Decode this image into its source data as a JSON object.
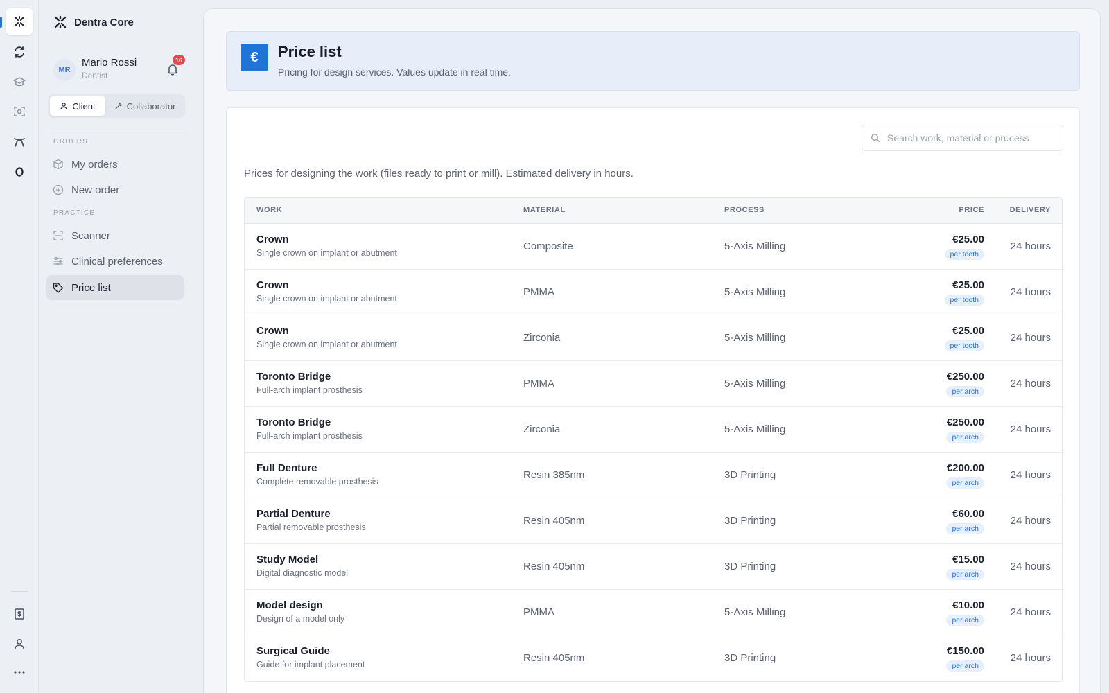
{
  "app": {
    "name": "Dentra Core"
  },
  "rail": {
    "items": [
      "logo-icon",
      "exchange-icon",
      "graduation-cap-icon",
      "scan-icon",
      "aligner-icon",
      "ring-icon",
      "invoice-icon",
      "user-icon",
      "more-icon"
    ]
  },
  "user": {
    "initials": "MR",
    "name": "Mario Rossi",
    "role": "Dentist",
    "notifications": "16"
  },
  "role_toggle": {
    "client": "Client",
    "collaborator": "Collaborator",
    "selected": "Client"
  },
  "nav": {
    "orders_label": "ORDERS",
    "my_orders": "My orders",
    "new_order": "New order",
    "practice_label": "PRACTICE",
    "scanner": "Scanner",
    "clinical_preferences": "Clinical preferences",
    "price_list": "Price list",
    "active": "Price list"
  },
  "header": {
    "icon": "€",
    "title": "Price list",
    "subtitle": "Pricing for design services. Values update in real time."
  },
  "search": {
    "placeholder": "Search work, material or process",
    "value": ""
  },
  "description": "Prices for designing the work (files ready to print or mill). Estimated delivery in hours.",
  "table": {
    "columns": {
      "work": "WORK",
      "material": "MATERIAL",
      "process": "PROCESS",
      "price": "PRICE",
      "delivery": "DELIVERY"
    },
    "rows": [
      {
        "name": "Crown",
        "desc": "Single crown on implant or abutment",
        "material": "Composite",
        "process": "5-Axis Milling",
        "price": "€25.00",
        "unit": "per tooth",
        "delivery": "24 hours"
      },
      {
        "name": "Crown",
        "desc": "Single crown on implant or abutment",
        "material": "PMMA",
        "process": "5-Axis Milling",
        "price": "€25.00",
        "unit": "per tooth",
        "delivery": "24 hours"
      },
      {
        "name": "Crown",
        "desc": "Single crown on implant or abutment",
        "material": "Zirconia",
        "process": "5-Axis Milling",
        "price": "€25.00",
        "unit": "per tooth",
        "delivery": "24 hours"
      },
      {
        "name": "Toronto Bridge",
        "desc": "Full-arch implant prosthesis",
        "material": "PMMA",
        "process": "5-Axis Milling",
        "price": "€250.00",
        "unit": "per arch",
        "delivery": "24 hours"
      },
      {
        "name": "Toronto Bridge",
        "desc": "Full-arch implant prosthesis",
        "material": "Zirconia",
        "process": "5-Axis Milling",
        "price": "€250.00",
        "unit": "per arch",
        "delivery": "24 hours"
      },
      {
        "name": "Full Denture",
        "desc": "Complete removable prosthesis",
        "material": "Resin 385nm",
        "process": "3D Printing",
        "price": "€200.00",
        "unit": "per arch",
        "delivery": "24 hours"
      },
      {
        "name": "Partial Denture",
        "desc": "Partial removable prosthesis",
        "material": "Resin 405nm",
        "process": "3D Printing",
        "price": "€60.00",
        "unit": "per arch",
        "delivery": "24 hours"
      },
      {
        "name": "Study Model",
        "desc": "Digital diagnostic model",
        "material": "Resin 405nm",
        "process": "3D Printing",
        "price": "€15.00",
        "unit": "per arch",
        "delivery": "24 hours"
      },
      {
        "name": "Model design",
        "desc": "Design of a model only",
        "material": "PMMA",
        "process": "5-Axis Milling",
        "price": "€10.00",
        "unit": "per arch",
        "delivery": "24 hours"
      },
      {
        "name": "Surgical Guide",
        "desc": "Guide for implant placement",
        "material": "Resin 405nm",
        "process": "3D Printing",
        "price": "€150.00",
        "unit": "per arch",
        "delivery": "24 hours"
      }
    ]
  },
  "colors": {
    "accent": "#1f74d8",
    "badge": "#e5484d",
    "unit_bg": "#e6effc"
  }
}
